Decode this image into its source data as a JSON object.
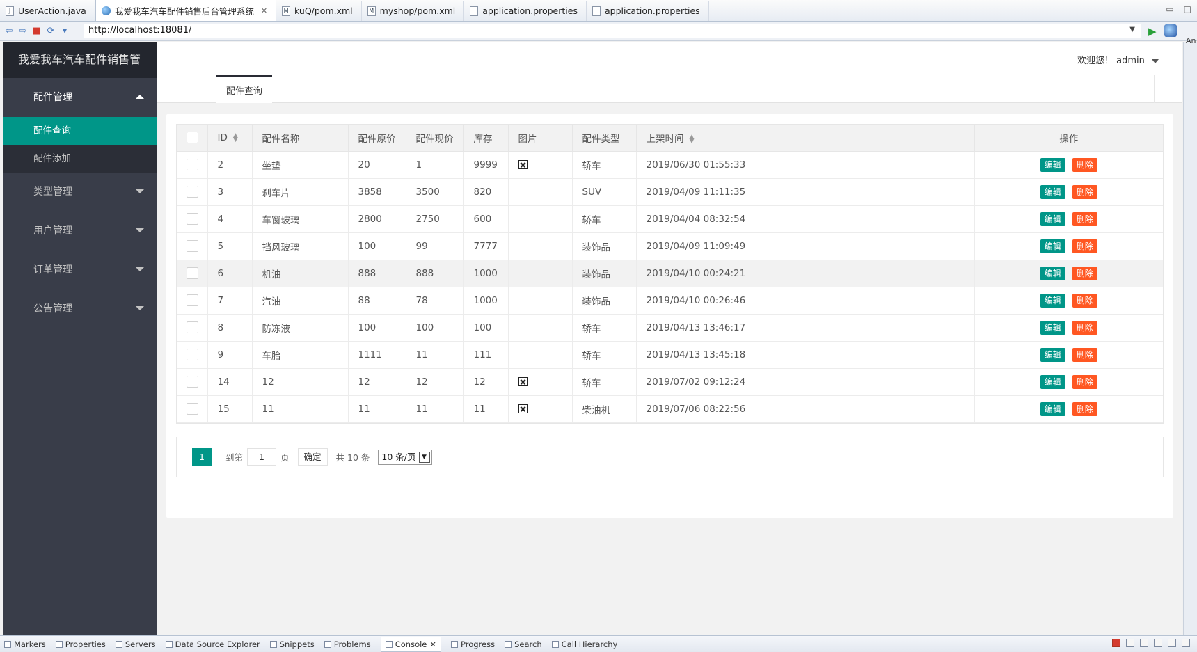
{
  "editor_tabs": [
    {
      "label": "UserAction.java",
      "icon": "java-file-icon",
      "active": false
    },
    {
      "label": "我爱我车汽车配件销售后台管理系统",
      "icon": "globe-icon",
      "active": true,
      "close": "✕"
    },
    {
      "label": "kuQ/pom.xml",
      "icon": "maven-file-icon",
      "active": false
    },
    {
      "label": "myshop/pom.xml",
      "icon": "maven-file-icon",
      "active": false
    },
    {
      "label": "application.properties",
      "icon": "properties-file-icon",
      "active": false
    },
    {
      "label": "application.properties",
      "icon": "properties-file-icon",
      "active": false
    }
  ],
  "browser": {
    "url": "http://localhost:18081/"
  },
  "sidebar": {
    "logo": "我爱我车汽车配件销售管",
    "groups": [
      {
        "label": "配件管理",
        "expanded": true,
        "items": [
          {
            "label": "配件查询",
            "active": true
          },
          {
            "label": "配件添加",
            "active": false
          }
        ]
      },
      {
        "label": "类型管理",
        "expanded": false
      },
      {
        "label": "用户管理",
        "expanded": false
      },
      {
        "label": "订单管理",
        "expanded": false
      },
      {
        "label": "公告管理",
        "expanded": false
      }
    ]
  },
  "header": {
    "welcome": "欢迎您！",
    "username": "admin"
  },
  "page_tab": "配件查询",
  "table": {
    "columns": [
      "ID",
      "配件名称",
      "配件原价",
      "配件现价",
      "库存",
      "图片",
      "配件类型",
      "上架时间",
      "操作"
    ],
    "edit_label": "编辑",
    "delete_label": "删除",
    "rows": [
      {
        "id": "2",
        "name": "坐垫",
        "orig": "20",
        "price": "1",
        "stock": "9999",
        "img": true,
        "type": "轿车",
        "time": "2019/06/30 01:55:33"
      },
      {
        "id": "3",
        "name": "刹车片",
        "orig": "3858",
        "price": "3500",
        "stock": "820",
        "img": false,
        "type": "SUV",
        "time": "2019/04/09 11:11:35"
      },
      {
        "id": "4",
        "name": "车窗玻璃",
        "orig": "2800",
        "price": "2750",
        "stock": "600",
        "img": false,
        "type": "轿车",
        "time": "2019/04/04 08:32:54"
      },
      {
        "id": "5",
        "name": "挡风玻璃",
        "orig": "100",
        "price": "99",
        "stock": "7777",
        "img": false,
        "type": "装饰品",
        "time": "2019/04/09 11:09:49"
      },
      {
        "id": "6",
        "name": "机油",
        "orig": "888",
        "price": "888",
        "stock": "1000",
        "img": false,
        "type": "装饰品",
        "time": "2019/04/10 00:24:21"
      },
      {
        "id": "7",
        "name": "汽油",
        "orig": "88",
        "price": "78",
        "stock": "1000",
        "img": false,
        "type": "装饰品",
        "time": "2019/04/10 00:26:46"
      },
      {
        "id": "8",
        "name": "防冻液",
        "orig": "100",
        "price": "100",
        "stock": "100",
        "img": false,
        "type": "轿车",
        "time": "2019/04/13 13:46:17"
      },
      {
        "id": "9",
        "name": "车胎",
        "orig": "1111",
        "price": "11",
        "stock": "111",
        "img": false,
        "type": "轿车",
        "time": "2019/04/13 13:45:18"
      },
      {
        "id": "14",
        "name": "12",
        "orig": "12",
        "price": "12",
        "stock": "12",
        "img": true,
        "type": "轿车",
        "time": "2019/07/02 09:12:24"
      },
      {
        "id": "15",
        "name": "11",
        "orig": "11",
        "price": "11",
        "stock": "11",
        "img": true,
        "type": "柴油机",
        "time": "2019/07/06 08:22:56"
      }
    ]
  },
  "pager": {
    "current": "1",
    "goto_label": "到第",
    "goto_value": "1",
    "page_unit": "页",
    "confirm": "确定",
    "total": "共 10 条",
    "page_size": "10 条/页"
  },
  "ide": {
    "right_strip_label": "An",
    "bottom_tabs": [
      "Markers",
      "Properties",
      "Servers",
      "Data Source Explorer",
      "Snippets",
      "Problems",
      "Console",
      "Progress",
      "Search",
      "Call Hierarchy"
    ],
    "active_bottom_tab": "Console",
    "active_bottom_tab_close": "✕"
  }
}
